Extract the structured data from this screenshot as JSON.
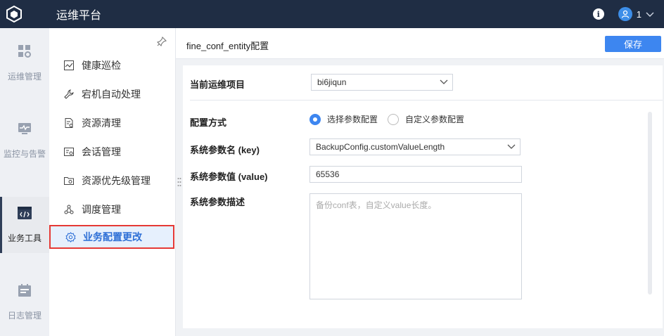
{
  "app": {
    "title": "运维平台"
  },
  "user": {
    "name": "1"
  },
  "rail": {
    "items": [
      {
        "label": "运维管理",
        "icon": "grid-gear-icon"
      },
      {
        "label": "监控与告警",
        "icon": "monitor-pulse-icon"
      },
      {
        "label": "业务工具",
        "icon": "code-window-icon",
        "active": true
      },
      {
        "label": "日志管理",
        "icon": "calendar-icon"
      }
    ]
  },
  "submenu": {
    "items": [
      {
        "label": "健康巡检",
        "icon": "health-chart-icon"
      },
      {
        "label": "宕机自动处理",
        "icon": "wrench-icon"
      },
      {
        "label": "资源清理",
        "icon": "doc-clean-icon"
      },
      {
        "label": "会话管理",
        "icon": "session-icon"
      },
      {
        "label": "资源优先级管理",
        "icon": "folder-priority-icon"
      },
      {
        "label": "调度管理",
        "icon": "schedule-nodes-icon"
      },
      {
        "label": "业务配置更改",
        "icon": "gear-icon",
        "active": true
      }
    ]
  },
  "page": {
    "title": "fine_conf_entity配置",
    "save_label": "保存"
  },
  "form": {
    "project_label": "当前运维项目",
    "project_value": "bi6jiqun",
    "config_mode_label": "配置方式",
    "mode_options": [
      "选择参数配置",
      "自定义参数配置"
    ],
    "mode_selected": "选择参数配置",
    "key_label": "系统参数名 (key)",
    "key_value": "BackupConfig.customValueLength",
    "value_label": "系统参数值 (value)",
    "value_value": "65536",
    "desc_label": "系统参数描述",
    "desc_placeholder": "备份conf表，自定义value长度。"
  },
  "colors": {
    "topbar": "#1f2d44",
    "accent": "#3d86f0",
    "highlight_border": "#e53935"
  }
}
